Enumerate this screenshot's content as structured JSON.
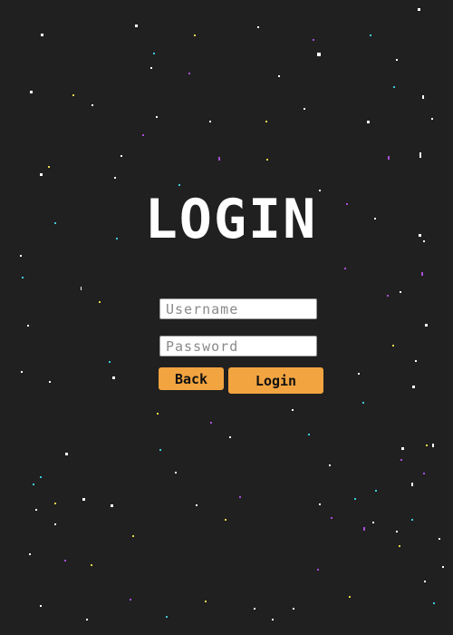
{
  "screen": {
    "title": "LOGIN",
    "background_color": "#202020",
    "accent_color": "#f2a440"
  },
  "form": {
    "username": {
      "placeholder": "Username",
      "value": ""
    },
    "password": {
      "placeholder": "Password",
      "value": ""
    },
    "back_label": "Back",
    "login_label": "Login"
  }
}
